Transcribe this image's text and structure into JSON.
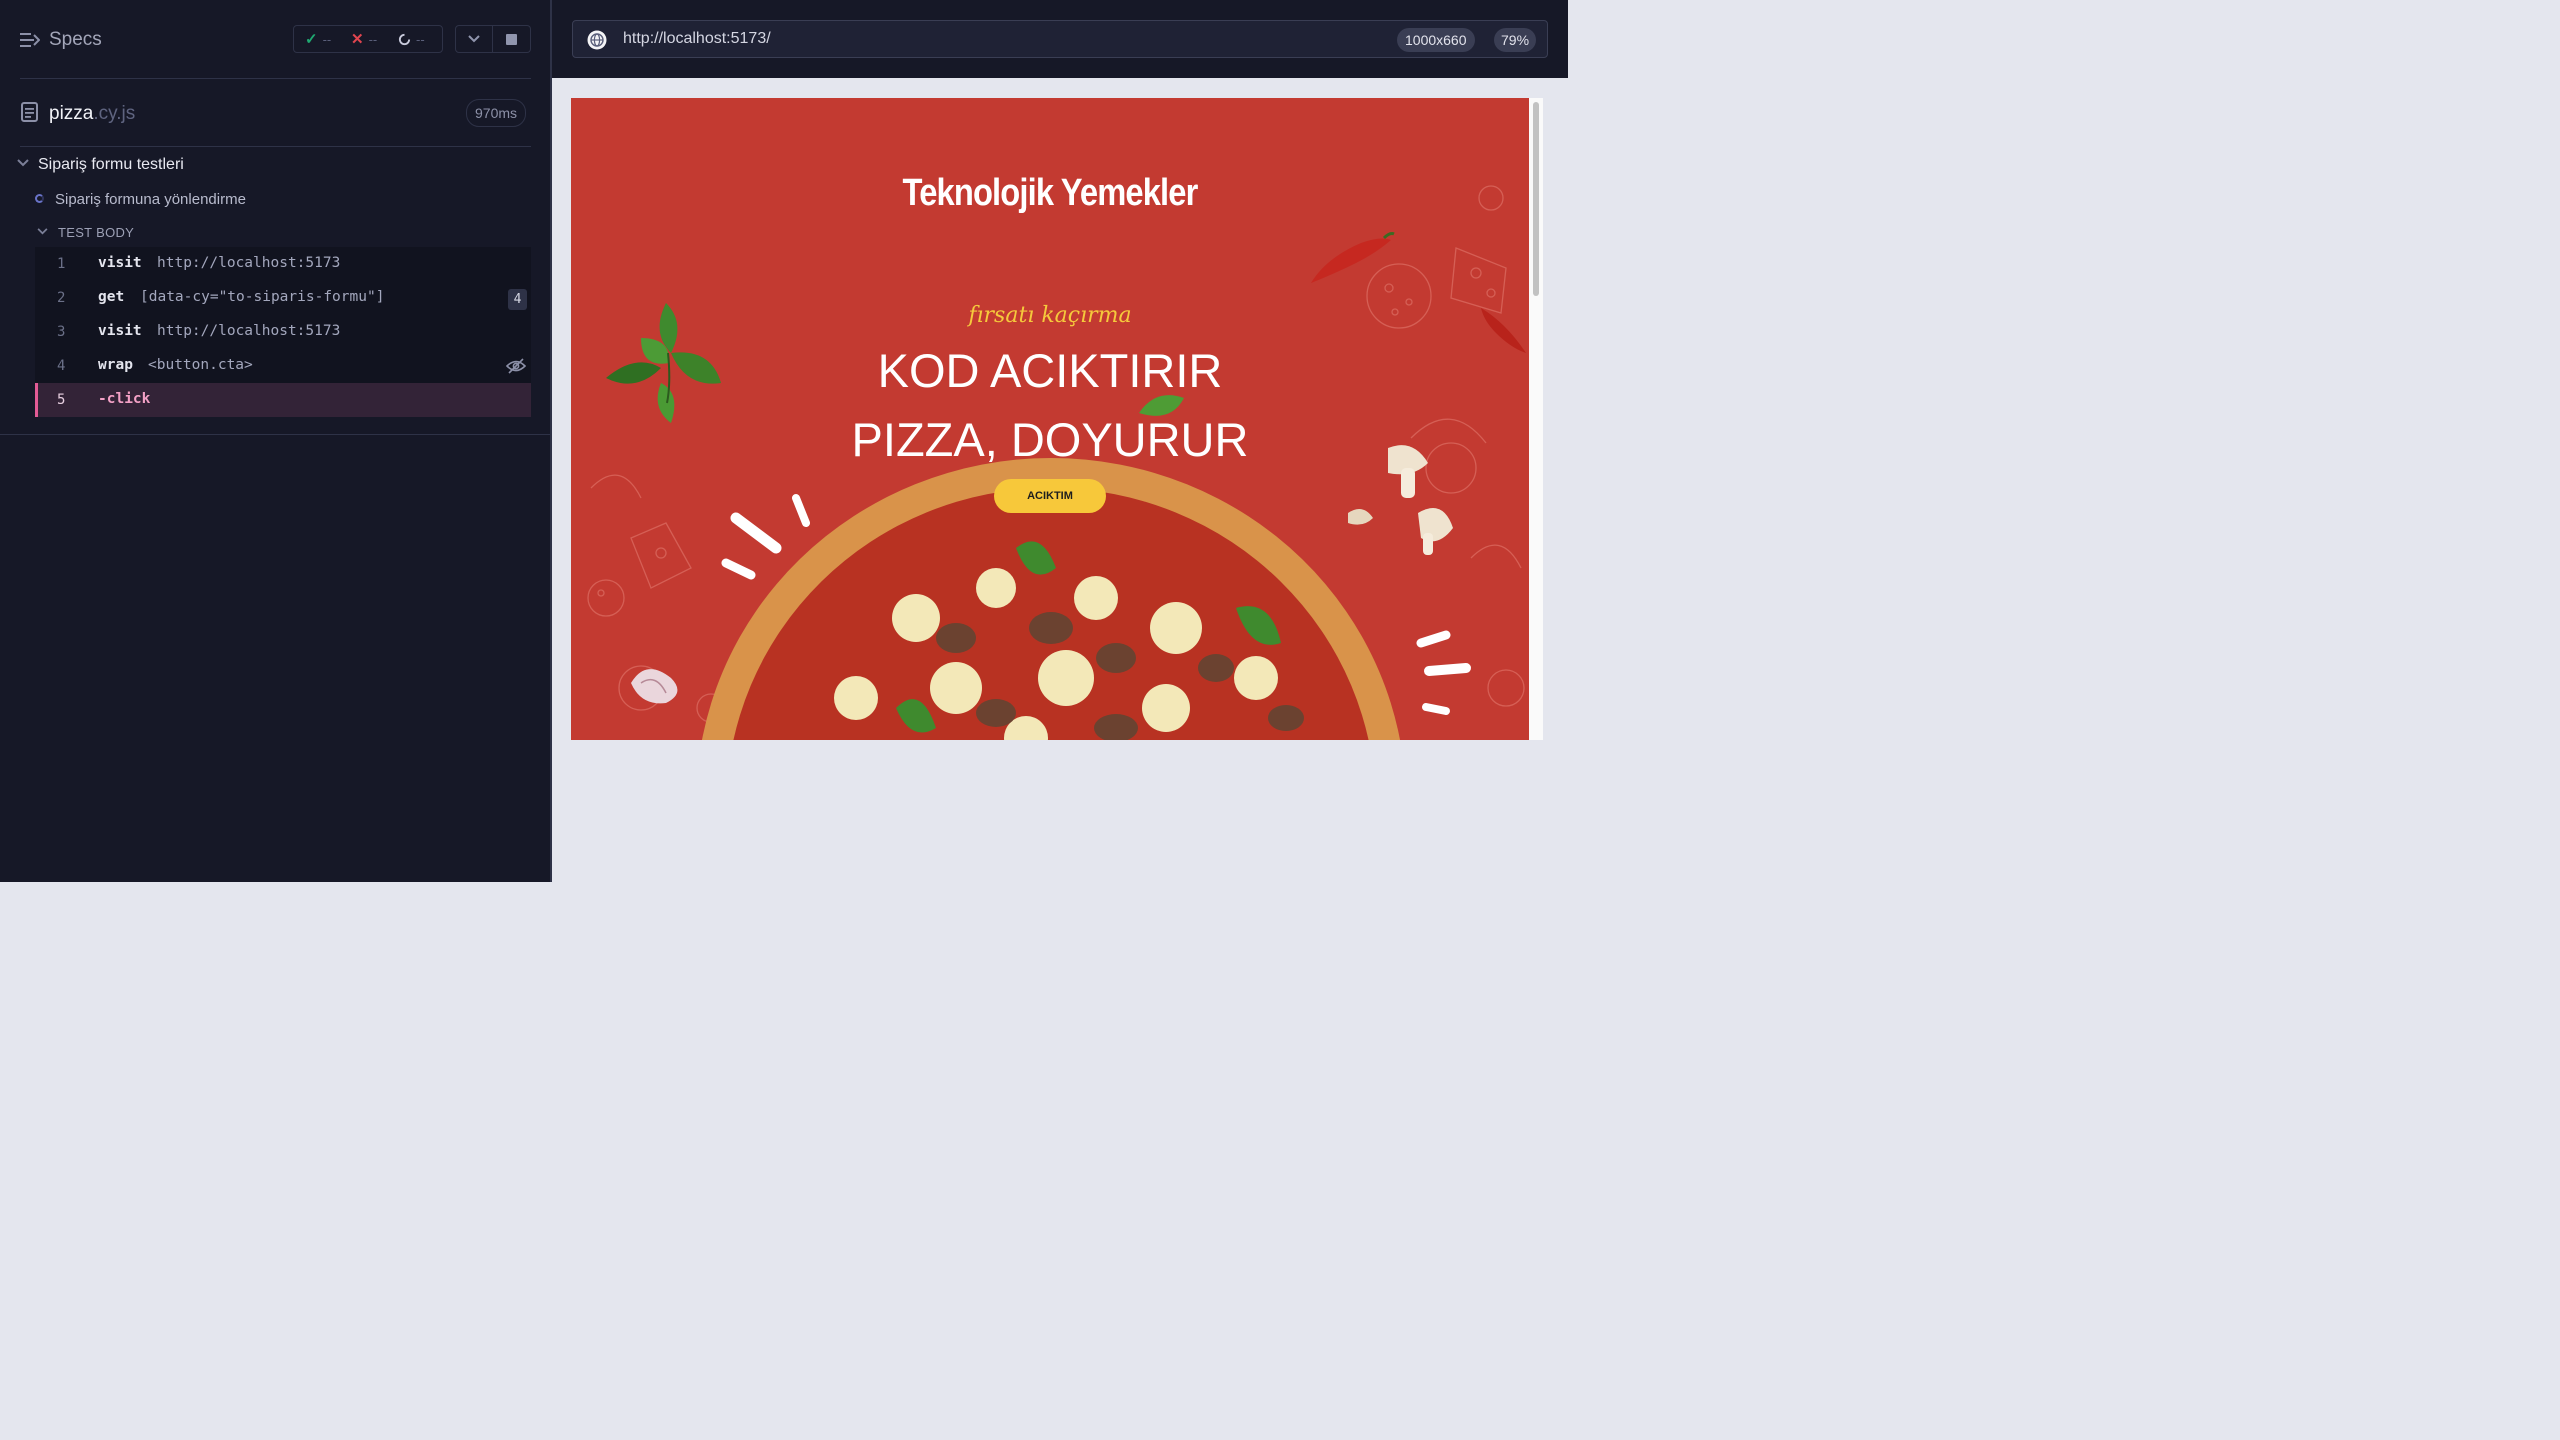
{
  "reporter": {
    "title": "Specs",
    "stats": {
      "passed": "--",
      "failed": "--",
      "pending": "--"
    },
    "spec_file": {
      "name": "pizza",
      "ext": ".cy.js",
      "duration": "970ms"
    },
    "suite_title": "Sipariş formu testleri",
    "test_title": "Sipariş formuna yönlendirme",
    "body_label": "TEST BODY",
    "commands": [
      {
        "num": "1",
        "name": "visit",
        "arg": "http://localhost:5173"
      },
      {
        "num": "2",
        "name": "get",
        "arg": "[data-cy=\"to-siparis-formu\"]",
        "count": "4"
      },
      {
        "num": "3",
        "name": "visit",
        "arg": "http://localhost:5173"
      },
      {
        "num": "4",
        "name": "wrap",
        "arg": "<button.cta>"
      },
      {
        "num": "5",
        "name": "-click",
        "arg": ""
      }
    ]
  },
  "url_bar": {
    "url": "http://localhost:5173/",
    "viewport": "1000x660",
    "scale": "79%"
  },
  "app": {
    "brand": "Teknolojik Yemekler",
    "tagline": "fırsatı kaçırma",
    "headline_1": "KOD ACIKTIRIR",
    "headline_2": "PIZZA, DOYURUR",
    "cta": "ACIKTIM"
  },
  "colors": {
    "accent_active": "#e25b95",
    "app_red": "#c33a31",
    "cta_yellow": "#f7c83a",
    "pass": "#1fa971",
    "fail": "#e0454f"
  },
  "icons": [
    "specs-list-icon",
    "check-icon",
    "x-icon",
    "spinner-icon",
    "chevron-down-icon",
    "stop-icon",
    "file-icon",
    "globe-icon",
    "eye-slash-icon"
  ]
}
